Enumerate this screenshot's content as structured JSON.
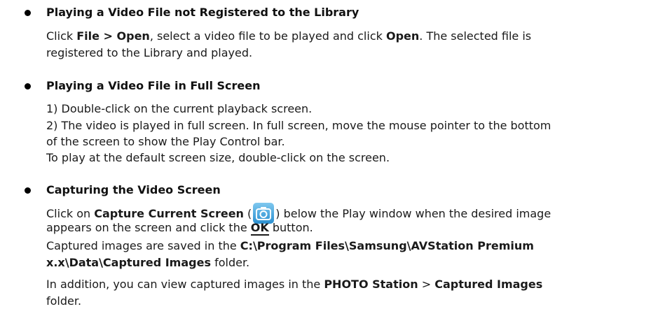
{
  "s1": {
    "heading": "Playing a Video File not Registered to the Library",
    "l1_a": "Click ",
    "l1_b": "File > Open",
    "l1_c": ", select a video file to be played and click ",
    "l1_d": "Open",
    "l1_e": ". The selected file is",
    "l2": "registered to the Library and played."
  },
  "s2": {
    "heading": "Playing a Video File in Full Screen",
    "l1": "1) Double-click on the current playback screen.",
    "l2": "2) The video is played in full screen. In full screen, move the mouse pointer to the bottom",
    "l3": "of the screen to show the Play Control bar.",
    "l4": "To play at the default screen size, double-click on the screen."
  },
  "s3": {
    "heading": "Capturing the Video Screen",
    "l1_a": "Click on ",
    "l1_b": "Capture Current Screen",
    "l1_c": " (",
    "l1_d": ") below the Play window when the desired image",
    "l2_a": "appears on the screen and click the ",
    "l2_b": "OK",
    "l2_c": " button.",
    "l3_a": "Captured images are saved in the ",
    "l3_b": "C:\\Program Files\\Samsung\\AVStation Premium",
    "l4": "x.x\\Data\\Captured Images",
    "l4_c": " folder.",
    "l5_a": "In addition, you can view captured images in the ",
    "l5_b": "PHOTO Station",
    "l5_c": " > ",
    "l5_d": "Captured Images",
    "l6": "folder."
  },
  "icons": [
    "camera-icon"
  ]
}
